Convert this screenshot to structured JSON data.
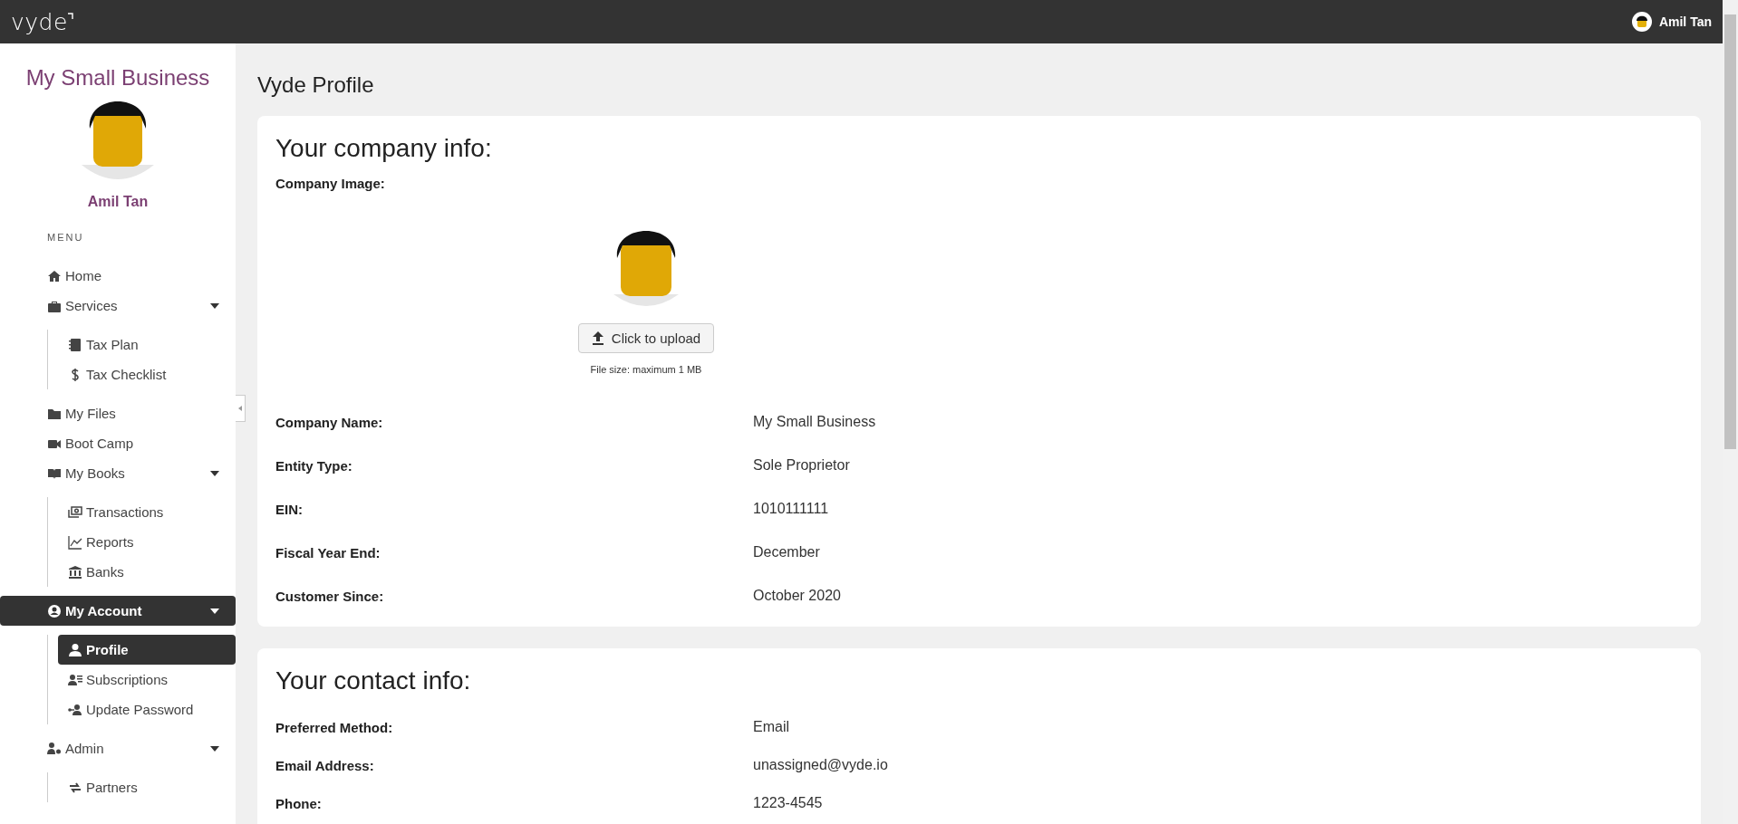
{
  "header": {
    "logo": "vyde",
    "user_name": "Amil Tan"
  },
  "sidebar": {
    "business_name": "My Small Business",
    "user_name": "Amil Tan",
    "menu_heading": "MENU",
    "items": [
      {
        "label": "Home",
        "selected": false
      },
      {
        "label": "Services",
        "selected": false,
        "expanded": true,
        "children": [
          {
            "label": "Tax Plan",
            "selected": false
          },
          {
            "label": "Tax Checklist",
            "selected": false
          }
        ]
      },
      {
        "label": "My Files",
        "selected": false
      },
      {
        "label": "Boot Camp",
        "selected": false
      },
      {
        "label": "My Books",
        "selected": false,
        "expanded": true,
        "children": [
          {
            "label": "Transactions",
            "selected": false
          },
          {
            "label": "Reports",
            "selected": false
          },
          {
            "label": "Banks",
            "selected": false
          }
        ]
      },
      {
        "label": "My Account",
        "selected": true,
        "expanded": true,
        "children": [
          {
            "label": "Profile",
            "selected": true
          },
          {
            "label": "Subscriptions",
            "selected": false
          },
          {
            "label": "Update Password",
            "selected": false
          }
        ]
      },
      {
        "label": "Admin",
        "selected": false,
        "expanded": true,
        "children": [
          {
            "label": "Partners",
            "selected": false
          }
        ]
      }
    ]
  },
  "page_title": "Vyde Profile",
  "company_card": {
    "title": "Your company info:",
    "image_label": "Company Image:",
    "upload_button": "Click to upload",
    "file_size_note": "File size: maximum 1 MB",
    "fields": [
      {
        "label": "Company Name:",
        "value": "My Small Business"
      },
      {
        "label": "Entity Type:",
        "value": "Sole Proprietor"
      },
      {
        "label": "EIN:",
        "value": "1010111111"
      },
      {
        "label": "Fiscal Year End:",
        "value": "December"
      },
      {
        "label": "Customer Since:",
        "value": "October 2020"
      }
    ]
  },
  "contact_card": {
    "title": "Your contact info:",
    "fields": [
      {
        "label": "Preferred Method:",
        "value": "Email"
      },
      {
        "label": "Email Address:",
        "value": "unassigned@vyde.io"
      },
      {
        "label": "Phone:",
        "value": "1223-4545"
      }
    ]
  }
}
